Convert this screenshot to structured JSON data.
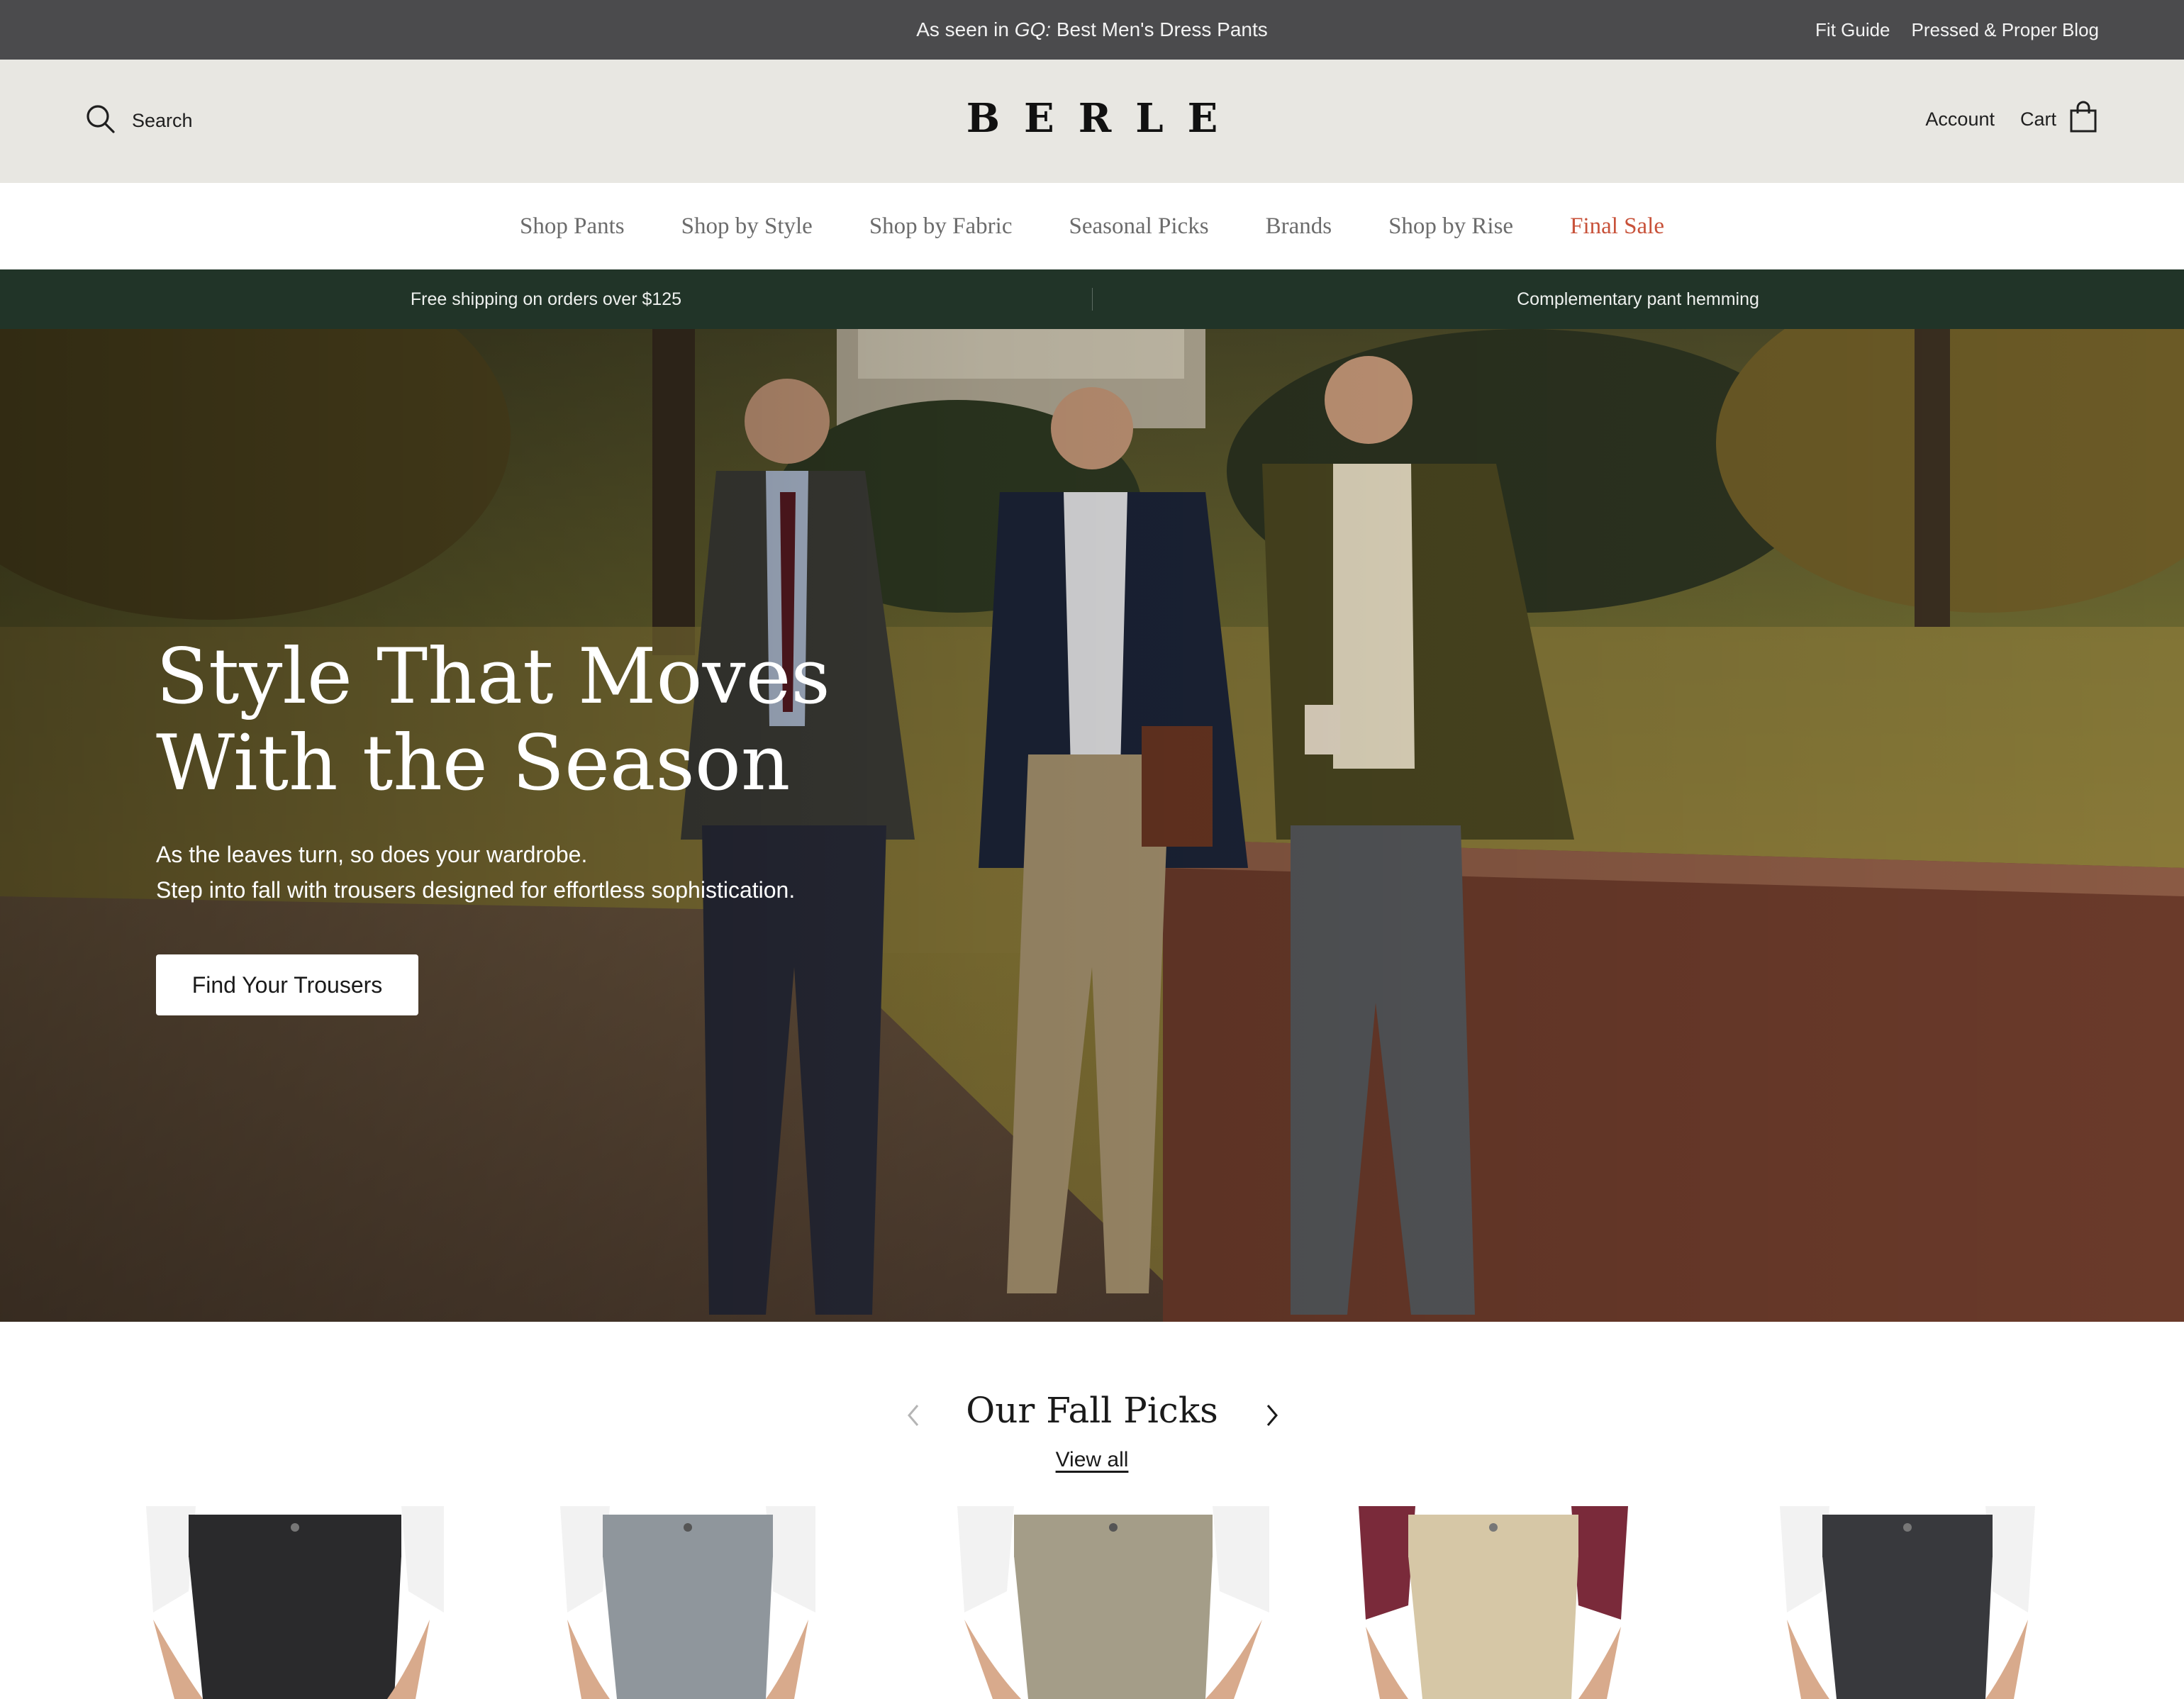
{
  "announcement": {
    "prefix": "As seen in ",
    "publication": "GQ:",
    "suffix": " Best Men's Dress Pants",
    "links": [
      "Fit Guide",
      "Pressed & Proper Blog"
    ]
  },
  "header": {
    "search_label": "Search",
    "logo": "BERLE",
    "account_label": "Account",
    "cart_label": "Cart"
  },
  "nav": {
    "items": [
      "Shop Pants",
      "Shop by Style",
      "Shop by Fabric",
      "Seasonal Picks",
      "Brands",
      "Shop by Rise",
      "Final Sale"
    ],
    "sale_color": "#c8523a"
  },
  "promo": {
    "left": "Free shipping on orders over $125",
    "right": "Complementary pant hemming"
  },
  "hero": {
    "headline_line1": "Style That Moves",
    "headline_line2": "With the Season",
    "sub_line1": "As the leaves turn, so does your wardrobe.",
    "sub_line2": "Step into fall with trousers designed for effortless sophistication.",
    "cta_label": "Find Your Trousers"
  },
  "picks": {
    "title": "Our Fall Picks",
    "view_all": "View all",
    "products": [
      {
        "name": "product-1",
        "pant_color": "#2a2a2c",
        "shirt_color": "#ffffff"
      },
      {
        "name": "product-2",
        "pant_color": "#8f969c",
        "shirt_color": "#ffffff"
      },
      {
        "name": "product-3",
        "pant_color": "#a49d88",
        "shirt_color": "#ffffff"
      },
      {
        "name": "product-4",
        "pant_color": "#d6c7a6",
        "shirt_color": "#7a2a3a"
      },
      {
        "name": "product-5",
        "pant_color": "#38393d",
        "shirt_color": "#ffffff"
      }
    ]
  },
  "colors": {
    "announcement_bg": "#4b4b4d",
    "header_bg": "#e8e7e2",
    "promo_bg": "#213428"
  }
}
